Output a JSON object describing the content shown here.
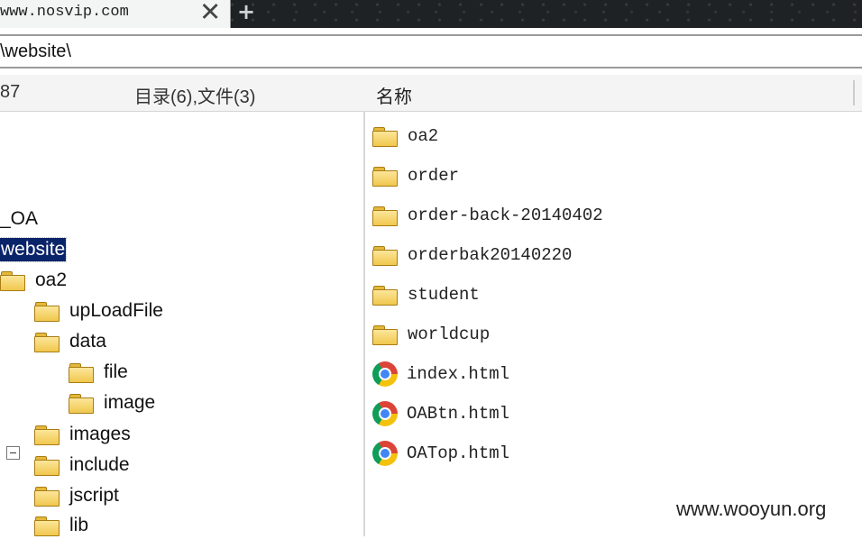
{
  "browser": {
    "tab_title": "www.nosvip.com",
    "close_glyph": "✕",
    "new_tab_glyph": "+",
    "colors": {
      "tab_strip": "#1f2224",
      "active_tab": "#f3f4f4"
    }
  },
  "path_bar": {
    "path": "\\website\\"
  },
  "header": {
    "count": "87",
    "summary": "目录(6),文件(3)",
    "name_column": "名称"
  },
  "tree": {
    "selected_color": "#0a246a",
    "nodes": [
      {
        "label": "_OA",
        "icon": "none"
      },
      {
        "label": "website",
        "icon": "none",
        "selected": true
      },
      {
        "label": "oa2",
        "icon": "folder-icon"
      },
      {
        "label": "upLoadFile",
        "icon": "folder-icon"
      },
      {
        "label": "data",
        "icon": "folder-icon",
        "expanded": true
      },
      {
        "label": "file",
        "icon": "folder-icon"
      },
      {
        "label": "image",
        "icon": "folder-icon"
      },
      {
        "label": "images",
        "icon": "folder-icon"
      },
      {
        "label": "include",
        "icon": "folder-icon"
      },
      {
        "label": "jscript",
        "icon": "folder-icon"
      },
      {
        "label": "lib",
        "icon": "folder-icon"
      }
    ]
  },
  "files": [
    {
      "name": "oa2",
      "type": "folder",
      "icon": "folder-icon"
    },
    {
      "name": "order",
      "type": "folder",
      "icon": "folder-icon"
    },
    {
      "name": "order-back-20140402",
      "type": "folder",
      "icon": "folder-icon"
    },
    {
      "name": "orderbak20140220",
      "type": "folder",
      "icon": "folder-icon"
    },
    {
      "name": "student",
      "type": "folder",
      "icon": "folder-icon"
    },
    {
      "name": "worldcup",
      "type": "folder",
      "icon": "folder-icon"
    },
    {
      "name": "index.html",
      "type": "html",
      "icon": "chrome-icon"
    },
    {
      "name": "OABtn.html",
      "type": "html",
      "icon": "chrome-icon"
    },
    {
      "name": "OATop.html",
      "type": "html",
      "icon": "chrome-icon"
    }
  ],
  "watermark": "www.wooyun.org"
}
